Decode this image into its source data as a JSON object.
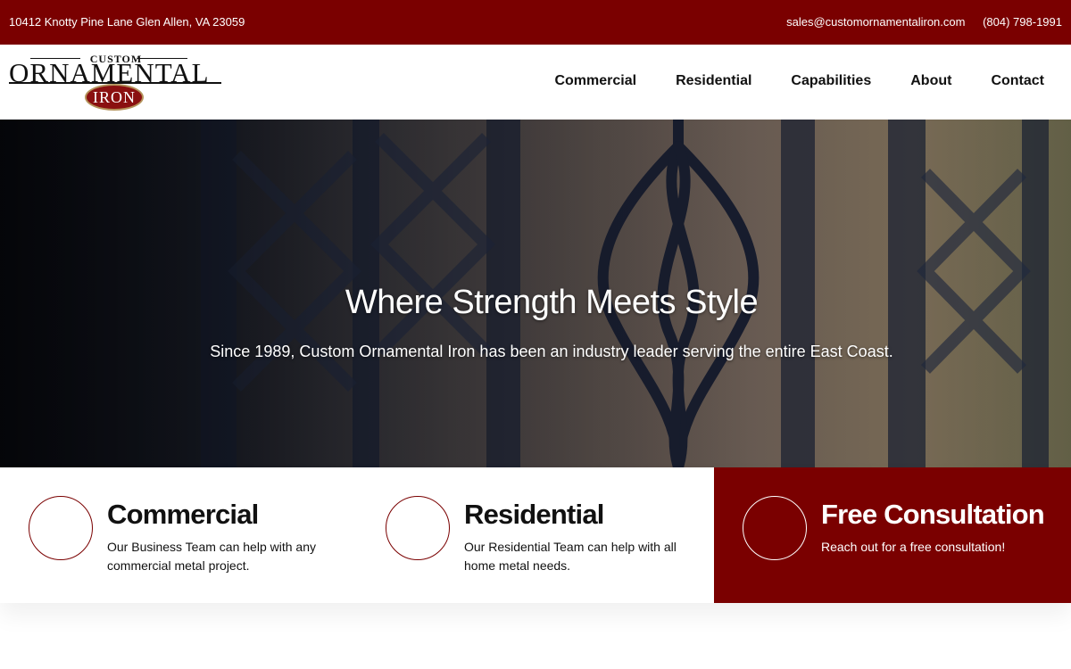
{
  "topbar": {
    "address": "10412 Knotty Pine Lane Glen Allen, VA 23059",
    "email": "sales@customornamentaliron.com",
    "phone": "(804) 798-1991",
    "background_color": "#7a0000"
  },
  "logo": {
    "line1": "CUSTOM",
    "line2": "ORNAMENTAL",
    "line3": "IRON"
  },
  "nav": {
    "items": [
      {
        "label": "Commercial"
      },
      {
        "label": "Residential"
      },
      {
        "label": "Capabilities"
      },
      {
        "label": "About"
      },
      {
        "label": "Contact"
      }
    ]
  },
  "hero": {
    "title": "Where Strength Meets Style",
    "subtitle": "Since 1989, Custom Ornamental Iron has been an industry leader serving the entire East Coast."
  },
  "cards": [
    {
      "title": "Commercial",
      "description": "Our Business Team can help with any commercial metal project."
    },
    {
      "title": "Residential",
      "description": "Our Residential Team can help with all home metal needs."
    },
    {
      "title": "Free Consultation",
      "description": "Reach out for a free consultation!"
    }
  ],
  "colors": {
    "accent": "#7a0000",
    "text": "#111111",
    "white": "#ffffff"
  }
}
